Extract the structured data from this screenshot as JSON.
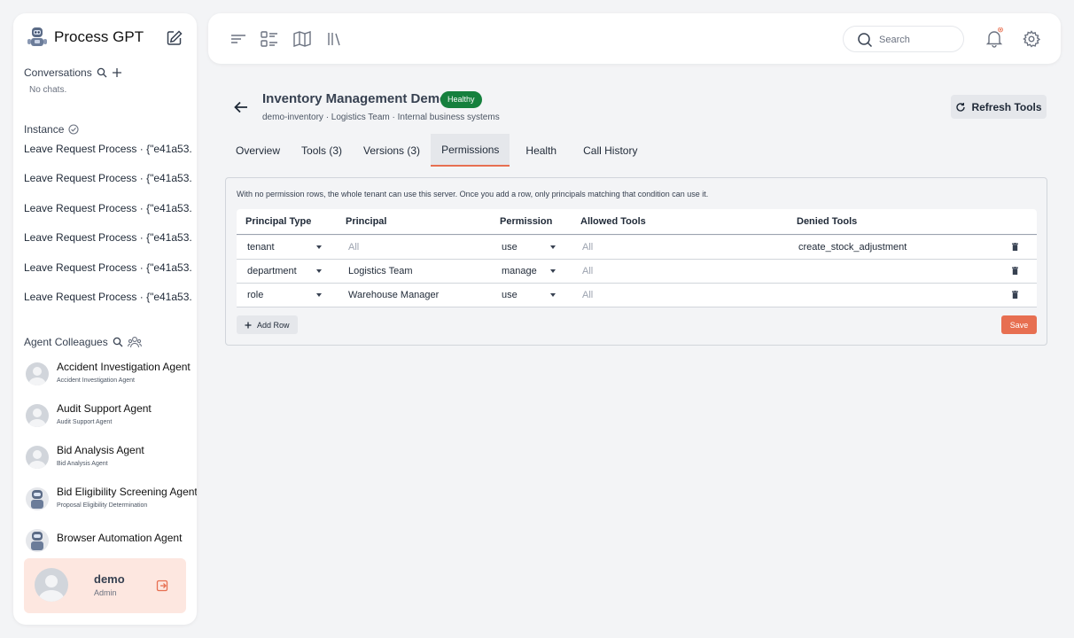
{
  "app": {
    "title": "Process GPT"
  },
  "sidebar": {
    "conversations_label": "Conversations",
    "no_chats": "No chats.",
    "instance_label": "Instance",
    "instances": [
      "Leave Request Process · {\"e41a53...",
      "Leave Request Process · {\"e41a53...",
      "Leave Request Process · {\"e41a53...",
      "Leave Request Process · {\"e41a53...",
      "Leave Request Process · {\"e41a53...",
      "Leave Request Process · {\"e41a53..."
    ],
    "agents_label": "Agent Colleagues",
    "agents": [
      {
        "name": "Accident Investigation Agent",
        "sub": "Accident Investigation Agent"
      },
      {
        "name": "Audit Support Agent",
        "sub": "Audit Support Agent"
      },
      {
        "name": "Bid Analysis Agent",
        "sub": "Bid Analysis Agent"
      },
      {
        "name": "Bid Eligibility Screening Agent",
        "sub": "Proposal Eligibility Determination"
      },
      {
        "name": "Browser Automation Agent",
        "sub": ""
      }
    ],
    "user": {
      "name": "demo",
      "role": "Admin"
    }
  },
  "topbar": {
    "search_placeholder": "Search"
  },
  "server": {
    "title": "Inventory Management Demo",
    "status": "Healthy",
    "meta": "demo-inventory · Logistics Team · Internal business systems",
    "refresh_label": "Refresh Tools"
  },
  "tabs": [
    "Overview",
    "Tools (3)",
    "Versions (3)",
    "Permissions",
    "Health",
    "Call History"
  ],
  "active_tab": "Permissions",
  "permissions": {
    "note": "With no permission rows, the whole tenant can use this server. Once you add a row, only principals matching that condition can use it.",
    "headers": {
      "principal_type": "Principal Type",
      "principal": "Principal",
      "permission": "Permission",
      "allowed": "Allowed Tools",
      "denied": "Denied Tools"
    },
    "rows": [
      {
        "type": "tenant",
        "principal": "",
        "principal_placeholder": "All",
        "permission": "use",
        "allowed": "",
        "allowed_placeholder": "All",
        "denied": "create_stock_adjustment"
      },
      {
        "type": "department",
        "principal": "Logistics Team",
        "principal_placeholder": "All",
        "permission": "manage",
        "allowed": "",
        "allowed_placeholder": "All",
        "denied": ""
      },
      {
        "type": "role",
        "principal": "Warehouse Manager",
        "principal_placeholder": "All",
        "permission": "use",
        "allowed": "",
        "allowed_placeholder": "All",
        "denied": ""
      }
    ],
    "add_row_label": "Add Row",
    "save_label": "Save"
  },
  "colors": {
    "accent": "#e76f51",
    "healthy": "#15803d",
    "user_card": "#fde7e0"
  }
}
